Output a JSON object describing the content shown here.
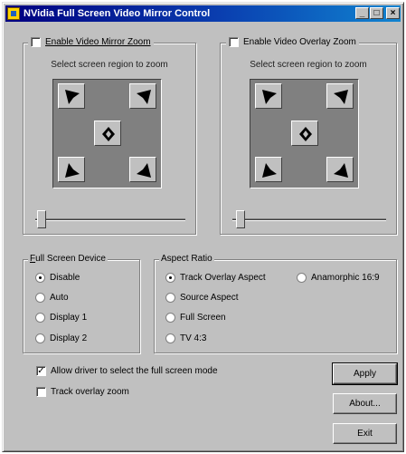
{
  "window": {
    "title": "NVidia Full Screen Video Mirror Control",
    "minimize": "_",
    "maximize": "□",
    "close": "×"
  },
  "mirror_zoom": {
    "checkbox_label": "Enable Video Mirror Zoom",
    "checked": false,
    "caption": "Select screen region to zoom"
  },
  "overlay_zoom": {
    "checkbox_label": "Enable Video Overlay Zoom",
    "checked": false,
    "caption": "Select screen region to zoom"
  },
  "full_screen_device": {
    "legend": "Full Screen Device",
    "options": [
      "Disable",
      "Auto",
      "Display 1",
      "Display 2"
    ],
    "selected": "Disable"
  },
  "aspect_ratio": {
    "legend": "Aspect Ratio",
    "options": [
      "Track Overlay Aspect",
      "Anamorphic 16:9",
      "Source Aspect",
      "Full Screen",
      "TV 4:3"
    ],
    "selected": "Track Overlay Aspect"
  },
  "options": {
    "allow_driver_label": "Allow driver to select the full screen mode",
    "allow_driver_checked": true,
    "track_zoom_label": "Track overlay zoom",
    "track_zoom_checked": false
  },
  "buttons": {
    "apply": "Apply",
    "about": "About...",
    "exit": "Exit"
  }
}
